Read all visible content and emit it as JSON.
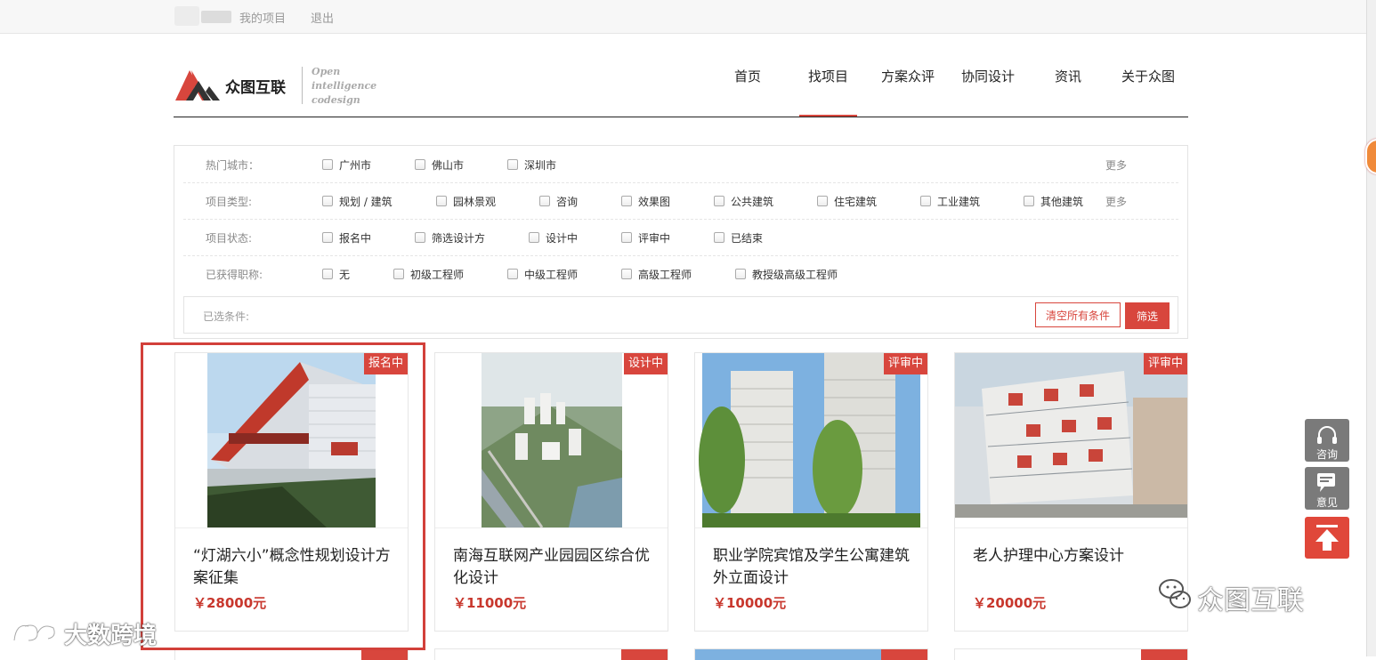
{
  "topbar": {
    "my_projects": "我的项目",
    "logout": "退出"
  },
  "logo": {
    "brand": "众图互联",
    "tagline": [
      "Open",
      "intelligence",
      "codesign"
    ]
  },
  "nav": [
    {
      "label": "首页",
      "active": false
    },
    {
      "label": "找项目",
      "active": true
    },
    {
      "label": "方案众评",
      "active": false
    },
    {
      "label": "协同设计",
      "active": false
    },
    {
      "label": "资讯",
      "active": false
    },
    {
      "label": "关于众图",
      "active": false
    }
  ],
  "filters": {
    "cities": {
      "label": "热门城市：",
      "options": [
        "广州市",
        "佛山市",
        "深圳市"
      ],
      "more": "更多"
    },
    "types": {
      "label": "项目类型:",
      "options": [
        "规划 / 建筑",
        "园林景观",
        "咨询",
        "效果图",
        "公共建筑",
        "住宅建筑",
        "工业建筑",
        "其他建筑"
      ],
      "more": "更多"
    },
    "status": {
      "label": "项目状态:",
      "options": [
        "报名中",
        "筛选设计方",
        "设计中",
        "评审中",
        "已结束"
      ]
    },
    "titles": {
      "label": "已获得职称:",
      "options": [
        "无",
        "初级工程师",
        "中级工程师",
        "高级工程师",
        "教授级高级工程师"
      ]
    },
    "selected_label": "已选条件:",
    "clear_all": "清空所有条件",
    "filter_button": "筛选"
  },
  "projects": [
    {
      "badge": "报名中",
      "title": "“灯湖六小”概念性规划设计方案征集",
      "price": "￥28000元"
    },
    {
      "badge": "设计中",
      "title": "南海互联网产业园园区综合优化设计",
      "price": "￥11000元"
    },
    {
      "badge": "评审中",
      "title": "职业学院宾馆及学生公寓建筑外立面设计",
      "price": "￥10000元"
    },
    {
      "badge": "评审中",
      "title": "老人护理中心方案设计",
      "price": "￥20000元"
    }
  ],
  "sidebar": {
    "consult": "咨询",
    "feedback": "意见"
  },
  "watermarks": {
    "left": "大数跨境",
    "right": "众图互联"
  },
  "colors": {
    "accent": "#d8463d",
    "price": "#c8372d"
  }
}
